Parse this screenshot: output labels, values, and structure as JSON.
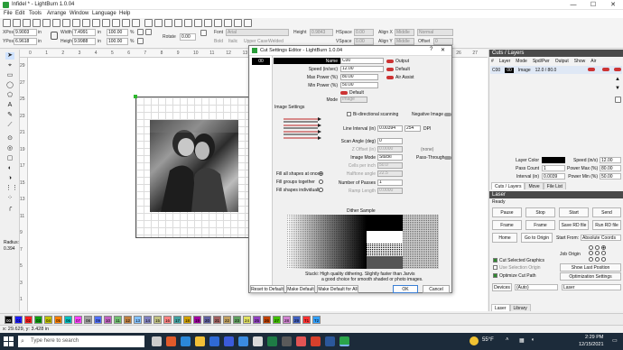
{
  "window": {
    "title": "Infidel * - LightBurn 1.0.04",
    "controls": {
      "minimize": "—",
      "maximize": "☐",
      "close": "✕"
    }
  },
  "menu": [
    "File",
    "Edit",
    "Tools",
    "Arrange",
    "Window",
    "Language",
    "Help"
  ],
  "toolbar": {
    "xpos_label": "XPos",
    "xpos": "9.9003",
    "ypos_label": "YPos",
    "ypos": "6.9618",
    "width_label": "Width",
    "width": "7.4991",
    "height_label": "Height",
    "height": "9.9988",
    "unit_in": "in",
    "pct_w": "100.00",
    "pct_h": "100.00",
    "pct_unit": "%",
    "rotate_label": "Rotate",
    "rotate": "0.00",
    "font_label": "Font",
    "font": "Arial",
    "height2_label": "Height",
    "height2": "0.9843",
    "hspace_label": "HSpace",
    "hspace": "0.00",
    "align_x_label": "Align X",
    "align_x": "Middle",
    "normal": "Normal",
    "bold": "Bold",
    "italic": "Italic",
    "upper": "Upper Case",
    "welded": "Welded",
    "vspace_label": "VSpace",
    "vspace": "0.00",
    "align_y_label": "Align Y",
    "align_y": "Middle",
    "offset_label": "Offset",
    "offset": "0"
  },
  "rulers": {
    "top": [
      "0",
      "1",
      "2",
      "3",
      "4",
      "5",
      "6",
      "7",
      "8",
      "9",
      "10",
      "11",
      "12",
      "13",
      "14",
      "15",
      "16",
      "17",
      "18",
      "19",
      "20",
      "21",
      "22",
      "23",
      "24",
      "25",
      "26",
      "27",
      "28"
    ],
    "left": [
      "29",
      "27",
      "25",
      "23",
      "21",
      "19",
      "17",
      "15",
      "13",
      "11",
      "9",
      "7",
      "5",
      "3",
      "1"
    ]
  },
  "left_tools": {
    "radius_label": "Radius:",
    "radius_value": "0.394"
  },
  "dialog": {
    "title": "Cut Settings Editor - LightBurn 1.0.04",
    "layer_id": "00",
    "name_label": "Name",
    "name_value": "C00",
    "output_label": "Output",
    "speed_label": "Speed (in/sec)",
    "speed": "12.00",
    "default_label": "Default",
    "max_power_label": "Max Power (%)",
    "max_power": "80.00",
    "air_assist_label": "Air Assist",
    "min_power_label": "Min Power (%)",
    "min_power": "50.00",
    "default2_label": "Default",
    "mode_label": "Mode",
    "mode": "Image",
    "image_settings_label": "Image Settings",
    "bidir_label": "Bi-directional scanning",
    "negative_label": "Negative Image",
    "line_interval_label": "Line Interval (in)",
    "line_interval": "0.00394",
    "dpi_value": "254",
    "dpi_label": "DPI",
    "scan_angle_label": "Scan Angle (deg)",
    "scan_angle": "0",
    "z_offset_label": "Z Offset (in)",
    "z_offset": "0.0000",
    "none_label": "(none)",
    "image_mode_label": "Image Mode",
    "image_mode": "Stucki",
    "pass_through_label": "Pass-Through",
    "cells_label": "Cells per inch",
    "cells": "50.0",
    "halftone_label": "Halftone angle",
    "halftone": "22.5",
    "fill_all_label": "Fill all shapes at once",
    "fill_groups_label": "Fill groups together",
    "fill_individual_label": "Fill shapes individually",
    "passes_label": "Number of Passes",
    "passes": "1",
    "ramp_label": "Ramp Length",
    "ramp": "0.0000",
    "dither_label": "Dither Sample",
    "desc_line1": "Stucki: High quality dithering. Slightly faster than Jarvis",
    "desc_line2": "a good choice for smooth shaded or photo images.",
    "reset_button": "Reset to Default",
    "make_default_button": "Make Default",
    "make_default_all_button": "Make Default for All",
    "ok_button": "OK",
    "cancel_button": "Cancel"
  },
  "cuts_panel": {
    "title": "Cuts / Layers",
    "headers": [
      "#",
      "Layer",
      "Mode",
      "Spd/Pwr",
      "Output",
      "Show",
      "Air"
    ],
    "row": {
      "num": "C00",
      "layer": "00",
      "mode": "Image",
      "spd": "12.0 / 80.0"
    },
    "layer_color_label": "Layer Color",
    "speed_label": "Speed (in/s)",
    "speed": "12.00",
    "pass_count_label": "Pass Count",
    "pass_count": "1",
    "power_max_label": "Power Max (%)",
    "power_max": "80.00",
    "interval_label": "Interval (in)",
    "interval": "0.0039",
    "power_min_label": "Power Min (%)",
    "power_min": "50.00",
    "tabs": [
      "Cuts / Layers",
      "Move",
      "File List"
    ]
  },
  "laser_panel": {
    "title": "Laser",
    "status": "Ready",
    "pause": "Pause",
    "stop": "Stop",
    "start": "Start",
    "send": "Send",
    "frame1": "Frame",
    "frame2": "Frame",
    "save_rd": "Save RD file",
    "run_rd": "Run RD file",
    "home": "Home",
    "goto_origin": "Go to Origin",
    "start_from_label": "Start From:",
    "start_from": "Absolute Coords",
    "job_origin_label": "Job Origin",
    "cut_selected": "Cut Selected Graphics",
    "use_selection": "Use Selection Origin",
    "show_last": "Show Last Position",
    "optimize_cut": "Optimize Cut Path",
    "optimization": "Optimization Settings",
    "devices_label": "Devices",
    "devices": "(Auto)",
    "device_name": "Laser",
    "tabs": [
      "Laser",
      "Library"
    ]
  },
  "colorbar": [
    "00",
    "01",
    "02",
    "03",
    "04",
    "05",
    "06",
    "07",
    "08",
    "09",
    "10",
    "11",
    "12",
    "13",
    "14",
    "15",
    "16",
    "17",
    "18",
    "19",
    "20",
    "21",
    "22",
    "23",
    "24",
    "25",
    "26",
    "27",
    "28",
    "29",
    "T1",
    "T2"
  ],
  "colorbar_colors": [
    "#000000",
    "#1a1aff",
    "#ff2020",
    "#10a010",
    "#c0c000",
    "#ff8000",
    "#00c0c0",
    "#ff40ff",
    "#a0a0a0",
    "#5070ff",
    "#c060c0",
    "#70c070",
    "#c08040",
    "#80c0ff",
    "#8080c0",
    "#c0c080",
    "#ff8080",
    "#40a0a0",
    "#d0a000",
    "#a000a0",
    "#6060a0",
    "#a06060",
    "#c0a060",
    "#60a060",
    "#e0e060",
    "#9040c0",
    "#c04000",
    "#40c000",
    "#d080d0",
    "#4060c0",
    "#ff3030",
    "#30a0ff"
  ],
  "status": {
    "coords": "x: 29.629, y: 3.428 in"
  },
  "taskbar": {
    "search": "Type here to search",
    "temp": "55°F",
    "time": "2:29 PM",
    "date": "12/15/2021"
  }
}
